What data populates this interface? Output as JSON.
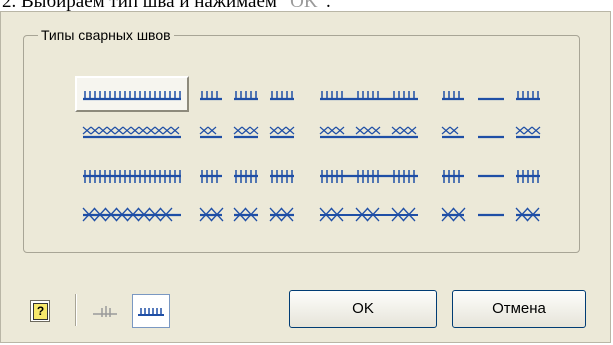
{
  "instruction": {
    "prefix": "2. Выбираем тип шва и нажимаем “",
    "ok_word": "OK",
    "suffix": "”."
  },
  "group": {
    "title": "Типы сварных швов"
  },
  "seam_color": "#1f4fa6",
  "seams": [
    {
      "row": 1,
      "col": 1,
      "kind": "continuous",
      "mark": "tick",
      "selected": true
    },
    {
      "row": 1,
      "col": 2,
      "kind": "intermittent",
      "mark": "tick",
      "selected": false
    },
    {
      "row": 1,
      "col": 3,
      "kind": "long-intermittent",
      "mark": "tick",
      "selected": false
    },
    {
      "row": 1,
      "col": 4,
      "kind": "dash-dot",
      "mark": "tick",
      "selected": false
    },
    {
      "row": 2,
      "col": 1,
      "kind": "continuous",
      "mark": "cross-small",
      "selected": false
    },
    {
      "row": 2,
      "col": 2,
      "kind": "intermittent",
      "mark": "cross-small",
      "selected": false
    },
    {
      "row": 2,
      "col": 3,
      "kind": "long-intermittent",
      "mark": "cross-small",
      "selected": false
    },
    {
      "row": 2,
      "col": 4,
      "kind": "dash-dot",
      "mark": "cross-small",
      "selected": false
    },
    {
      "row": 3,
      "col": 1,
      "kind": "continuous",
      "mark": "hash",
      "selected": false
    },
    {
      "row": 3,
      "col": 2,
      "kind": "intermittent",
      "mark": "hash",
      "selected": false
    },
    {
      "row": 3,
      "col": 3,
      "kind": "long-intermittent",
      "mark": "hash",
      "selected": false
    },
    {
      "row": 3,
      "col": 4,
      "kind": "dash-dot",
      "mark": "hash",
      "selected": false
    },
    {
      "row": 4,
      "col": 1,
      "kind": "continuous",
      "mark": "cross-large",
      "selected": false
    },
    {
      "row": 4,
      "col": 2,
      "kind": "intermittent",
      "mark": "cross-large",
      "selected": false
    },
    {
      "row": 4,
      "col": 3,
      "kind": "long-intermittent",
      "mark": "cross-large",
      "selected": false
    },
    {
      "row": 4,
      "col": 4,
      "kind": "dash-dot",
      "mark": "cross-large",
      "selected": false
    }
  ],
  "toolbar": {
    "help_icon": "help-icon",
    "help_glyph": "?",
    "view_buttons": [
      {
        "icon": "seam-side-view-icon",
        "active": false
      },
      {
        "icon": "seam-front-view-icon",
        "active": true
      }
    ]
  },
  "buttons": {
    "ok_label": "OK",
    "cancel_label": "Отмена"
  }
}
